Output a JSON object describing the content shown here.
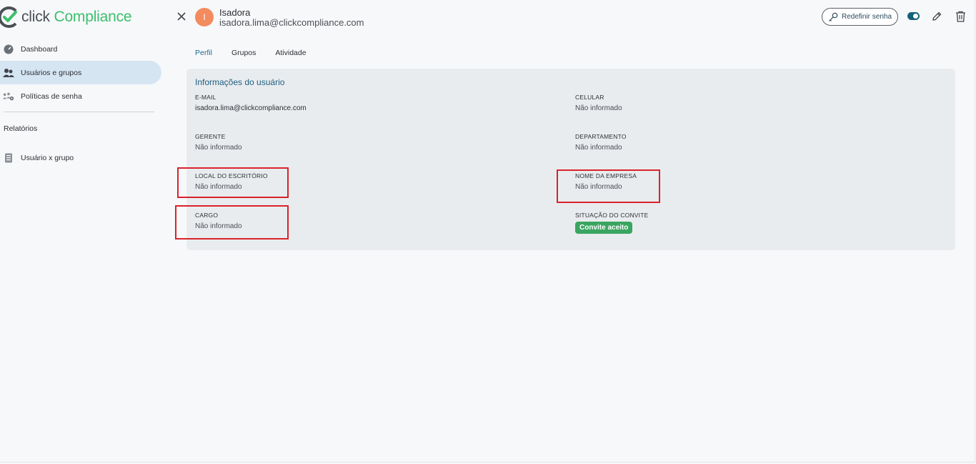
{
  "brand": {
    "part1": "click",
    "part2": "Compliance"
  },
  "sidebar": {
    "items": [
      {
        "label": "Dashboard",
        "icon": "dashboard-gauge-icon"
      },
      {
        "label": "Usuários e grupos",
        "icon": "users-icon",
        "active": true
      },
      {
        "label": "Políticas de senha",
        "icon": "password-policy-icon"
      }
    ],
    "section_title": "Relatórios",
    "reports": [
      {
        "label": "Usuário x grupo",
        "icon": "report-icon"
      }
    ]
  },
  "header": {
    "avatar_initial": "I",
    "user_name": "Isadora",
    "user_email": "isadora.lima@clickcompliance.com",
    "reset_password_label": "Redefinir senha",
    "toggle_on": true
  },
  "tabs": [
    {
      "label": "Perfil",
      "active": true
    },
    {
      "label": "Grupos"
    },
    {
      "label": "Atividade"
    }
  ],
  "card": {
    "title": "Informações do usuário",
    "fields": {
      "email": {
        "label": "E-MAIL",
        "value": "isadora.lima@clickcompliance.com"
      },
      "celular": {
        "label": "CELULAR",
        "value": "Não informado"
      },
      "gerente": {
        "label": "GERENTE",
        "value": "Não informado"
      },
      "departamento": {
        "label": "DEPARTAMENTO",
        "value": "Não informado"
      },
      "local": {
        "label": "LOCAL DO ESCRITÓRIO",
        "value": "Não informado"
      },
      "empresa": {
        "label": "NOME DA EMPRESA",
        "value": "Não informado"
      },
      "cargo": {
        "label": "CARGO",
        "value": "Não informado"
      },
      "convite": {
        "label": "SITUAÇÃO DO CONVITE",
        "value": "Convite aceito"
      }
    }
  },
  "colors": {
    "accent": "#1d6a8c",
    "brand_green": "#3bbf6b",
    "active_nav_bg": "#d6e5f2",
    "highlight_red": "#d9232a",
    "badge_green": "#3aa560"
  }
}
